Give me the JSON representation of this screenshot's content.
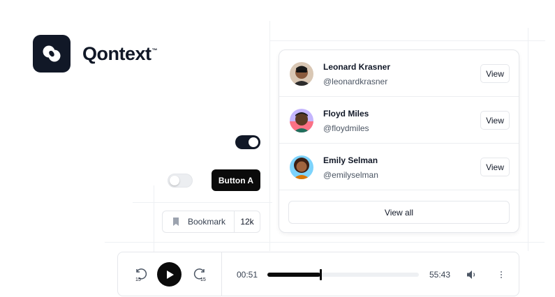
{
  "brand": {
    "name": "Qontext",
    "tm": "™",
    "logo_icon": "qontext-logo-icon"
  },
  "toggles": {
    "primary_on": true,
    "secondary_on": false
  },
  "button_a": {
    "label": "Button A"
  },
  "bookmark": {
    "label": "Bookmark",
    "count": "12k",
    "icon": "bookmark-icon"
  },
  "users": {
    "items": [
      {
        "name": "Leonard Krasner",
        "handle": "@leonardkrasner",
        "action": "View"
      },
      {
        "name": "Floyd Miles",
        "handle": "@floydmiles",
        "action": "View"
      },
      {
        "name": "Emily Selman",
        "handle": "@emilyselman",
        "action": "View"
      }
    ],
    "view_all": "View all"
  },
  "player": {
    "current_time": "00:51",
    "total_time": "55:43",
    "progress": 0.35,
    "rewind_seconds": "15",
    "forward_seconds": "15",
    "icons": [
      "rewind-15-icon",
      "play-icon",
      "forward-15-icon",
      "volume-icon",
      "more-vertical-icon"
    ]
  },
  "colors": {
    "primary": "#111827",
    "button": "#0b0b0b",
    "border": "#e5e7eb"
  }
}
